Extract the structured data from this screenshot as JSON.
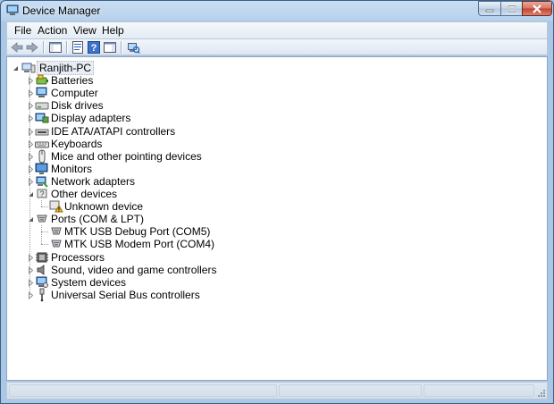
{
  "window": {
    "title": "Device Manager"
  },
  "menu": {
    "file": "File",
    "action": "Action",
    "view": "View",
    "help": "Help"
  },
  "tree": {
    "root": "Ranjith-PC",
    "items": [
      {
        "label": "Batteries",
        "icon": "battery-icon"
      },
      {
        "label": "Computer",
        "icon": "computer-icon"
      },
      {
        "label": "Disk drives",
        "icon": "disk-drive-icon"
      },
      {
        "label": "Display adapters",
        "icon": "display-adapter-icon"
      },
      {
        "label": "IDE ATA/ATAPI controllers",
        "icon": "ide-controller-icon"
      },
      {
        "label": "Keyboards",
        "icon": "keyboard-icon"
      },
      {
        "label": "Mice and other pointing devices",
        "icon": "mouse-icon"
      },
      {
        "label": "Monitors",
        "icon": "monitor-icon"
      },
      {
        "label": "Network adapters",
        "icon": "network-adapter-icon"
      },
      {
        "label": "Other devices",
        "icon": "other-devices-icon",
        "expanded": true,
        "children": [
          {
            "label": "Unknown device",
            "icon": "unknown-device-warning-icon"
          }
        ]
      },
      {
        "label": "Ports (COM & LPT)",
        "icon": "port-icon",
        "expanded": true,
        "children": [
          {
            "label": "MTK USB Debug Port (COM5)",
            "icon": "port-icon"
          },
          {
            "label": "MTK USB Modem Port (COM4)",
            "icon": "port-icon"
          }
        ]
      },
      {
        "label": "Processors",
        "icon": "processor-icon"
      },
      {
        "label": "Sound, video and game controllers",
        "icon": "speaker-icon"
      },
      {
        "label": "System devices",
        "icon": "system-device-icon"
      },
      {
        "label": "Universal Serial Bus controllers",
        "icon": "usb-icon"
      }
    ]
  },
  "colors": {
    "titlebar": "#b7d0ea",
    "close_button": "#c4432e",
    "tree_background": "#ffffff"
  }
}
